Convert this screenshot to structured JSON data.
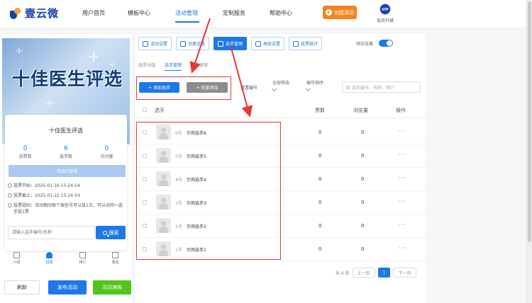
{
  "brand": {
    "name": "壹云微"
  },
  "nav": {
    "items": [
      {
        "label": "用户首页",
        "active": false
      },
      {
        "label": "模板中心",
        "active": false
      },
      {
        "label": "活动管理",
        "active": true
      },
      {
        "label": "定制服务",
        "active": false
      },
      {
        "label": "帮助中心",
        "active": false
      }
    ],
    "create_label": "创建活动",
    "vip_badge": "VIP",
    "vip_label": "会员升级"
  },
  "banner": {
    "title": "十佳医生评选"
  },
  "card": {
    "title": "十佳医生评选",
    "stats": [
      {
        "value": "0",
        "label": "总票数"
      },
      {
        "value": "6",
        "label": "选手数"
      },
      {
        "value": "0",
        "label": "访问量"
      }
    ],
    "status": "活动已结束",
    "vote_start": "投票开始：2025-01-16 15:24:54",
    "vote_end": "投票截止：2025-01-22 15:24:54",
    "vote_rule": "投票规则：活动期间每个微信号可以投1次，可以对同一选手投1票",
    "search_placeholder": "请输入选手编号/名称",
    "search_button": "搜索"
  },
  "bottom_tabs": [
    {
      "label": "介绍",
      "active": false
    },
    {
      "label": "投票",
      "active": true
    },
    {
      "label": "排行",
      "active": false
    },
    {
      "label": "报名",
      "active": false
    }
  ],
  "footer": {
    "refresh": "刷新",
    "publish": "发布活动",
    "poster": "活动海报"
  },
  "tool_tabs": [
    {
      "label": "活动设置",
      "active": false
    },
    {
      "label": "页面设置",
      "active": false
    },
    {
      "label": "选手管理",
      "active": true
    },
    {
      "label": "高级设置",
      "active": false
    },
    {
      "label": "投票统计",
      "active": false
    }
  ],
  "preview_label": "预览效果",
  "subtabs": [
    {
      "label": "选手分组",
      "active": false
    },
    {
      "label": "选手管理",
      "active": true
    },
    {
      "label": "报名审核",
      "active": false
    }
  ],
  "toolbar": {
    "add": "+ 添加选手",
    "batch": "+ 批量添加",
    "reset": "重置编号",
    "filter_all": "全部筛选",
    "sort": "编号倒序",
    "search_placeholder": "选手编号、名称、简介"
  },
  "table": {
    "headers": {
      "contestant": "选手",
      "votes": "票数",
      "views": "浏览量",
      "actions": "操作"
    },
    "rows": [
      {
        "num": "6号",
        "name": "示例选手6",
        "votes": "0",
        "views": "0"
      },
      {
        "num": "5号",
        "name": "示例选手5",
        "votes": "0",
        "views": "0"
      },
      {
        "num": "4号",
        "name": "示例选手4",
        "votes": "0",
        "views": "0"
      },
      {
        "num": "3号",
        "name": "示例选手3",
        "votes": "0",
        "views": "0"
      },
      {
        "num": "2号",
        "name": "示例选手2",
        "votes": "0",
        "views": "0"
      },
      {
        "num": "1号",
        "name": "示例选手1",
        "votes": "0",
        "views": "0"
      }
    ],
    "more": "···"
  },
  "pager": {
    "total": "共 6 条",
    "prev": "上一页",
    "current": "1",
    "next": "下一页"
  },
  "colors": {
    "primary": "#1e78e6",
    "create": "#f5841f",
    "poster": "#52c41a",
    "annotation": "#e53935"
  }
}
